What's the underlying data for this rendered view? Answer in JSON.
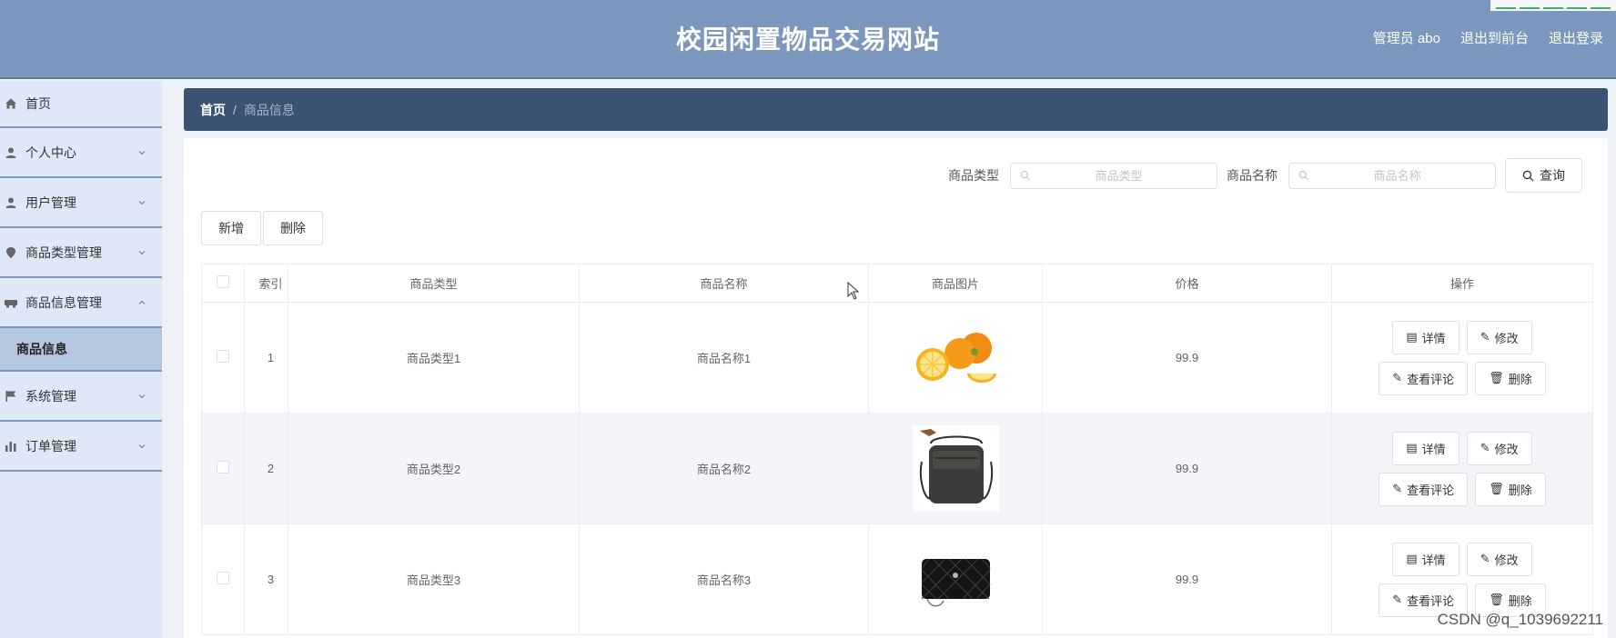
{
  "header": {
    "title": "校园闲置物品交易网站",
    "nav": [
      "管理员 abo",
      "退出到前台",
      "退出登录"
    ]
  },
  "sidebar": {
    "items": [
      {
        "label": "首页",
        "icon": "home-icon",
        "expandable": false
      },
      {
        "label": "个人中心",
        "icon": "user-icon",
        "expandable": true
      },
      {
        "label": "用户管理",
        "icon": "user-icon",
        "expandable": true
      },
      {
        "label": "商品类型管理",
        "icon": "pin-icon",
        "expandable": true
      },
      {
        "label": "商品信息管理",
        "icon": "car-icon",
        "expandable": true,
        "open": true
      },
      {
        "label": "系统管理",
        "icon": "flag-icon",
        "expandable": true
      },
      {
        "label": "订单管理",
        "icon": "chart-icon",
        "expandable": true
      }
    ],
    "active_sub": "商品信息"
  },
  "breadcrumb": {
    "home": "首页",
    "separator": "/",
    "current": "商品信息"
  },
  "search": {
    "type_label": "商品类型",
    "type_placeholder": "商品类型",
    "name_label": "商品名称",
    "name_placeholder": "商品名称",
    "query_label": "查询"
  },
  "actions": {
    "add": "新增",
    "delete": "删除"
  },
  "table": {
    "headers": [
      "索引",
      "商品类型",
      "商品名称",
      "商品图片",
      "价格",
      "操作"
    ],
    "rows": [
      {
        "index": "1",
        "type": "商品类型1",
        "name": "商品名称1",
        "image": "oranges",
        "price": "99.9"
      },
      {
        "index": "2",
        "type": "商品类型2",
        "name": "商品名称2",
        "image": "shoulder-bag",
        "price": "99.9"
      },
      {
        "index": "3",
        "type": "商品类型3",
        "name": "商品名称3",
        "image": "quilted-handbag",
        "price": "99.9"
      }
    ],
    "row_buttons": {
      "detail": "详情",
      "edit": "修改",
      "comments": "查看评论",
      "delete": "删除"
    }
  },
  "watermark": "CSDN @q_1039692211",
  "colors": {
    "header_bg": "#7b97bd",
    "breadcrumb_bg": "#3c5273",
    "sidebar_bg": "#dfe8f6",
    "sidebar_active": "#b5c6e0"
  }
}
